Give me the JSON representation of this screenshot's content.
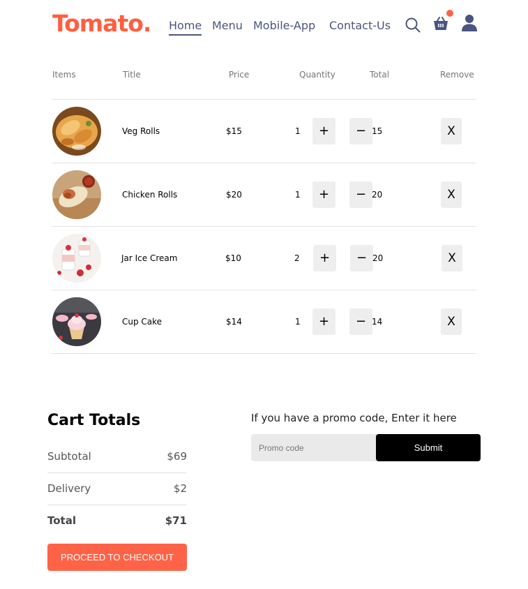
{
  "brand": {
    "logo_text": "Tomato."
  },
  "nav": {
    "items": [
      {
        "label": "Home"
      },
      {
        "label": "Menu"
      },
      {
        "label": "Mobile-App"
      },
      {
        "label": "Contact-Us"
      }
    ],
    "icons": [
      "search-icon",
      "basket-icon",
      "user-icon"
    ],
    "accent_color": "#49557e"
  },
  "cart": {
    "headers": [
      "Items",
      "Title",
      "Price",
      "Quantity",
      "Total",
      "Remove"
    ],
    "rows": [
      {
        "title": "Veg Rolls",
        "price": "$15",
        "qty": "1",
        "plus": "+",
        "minus": "−",
        "total": "15",
        "remove": "X"
      },
      {
        "title": "Chicken Rolls",
        "price": "$20",
        "qty": "1",
        "plus": "+",
        "minus": "−",
        "total": "20",
        "remove": "X"
      },
      {
        "title": "Jar Ice Cream",
        "price": "$10",
        "qty": "2",
        "plus": "+",
        "minus": "−",
        "total": "20",
        "remove": "X"
      },
      {
        "title": "Cup Cake",
        "price": "$14",
        "qty": "1",
        "plus": "+",
        "minus": "−",
        "total": "14",
        "remove": "X"
      }
    ]
  },
  "totals": {
    "title": "Cart Totals",
    "subtotal_label": "Subtotal",
    "subtotal_value": "$69",
    "delivery_label": "Delivery",
    "delivery_value": "$2",
    "total_label": "Total",
    "total_value": "$71",
    "checkout_label": "PROCEED TO CHECKOUT"
  },
  "promo": {
    "prompt": "If you have a promo code, Enter it here",
    "placeholder": "Promo code",
    "submit_label": "Submit"
  },
  "colors": {
    "brand": "#ff5f3f",
    "checkout": "#ff6347",
    "submit": "#000000"
  }
}
